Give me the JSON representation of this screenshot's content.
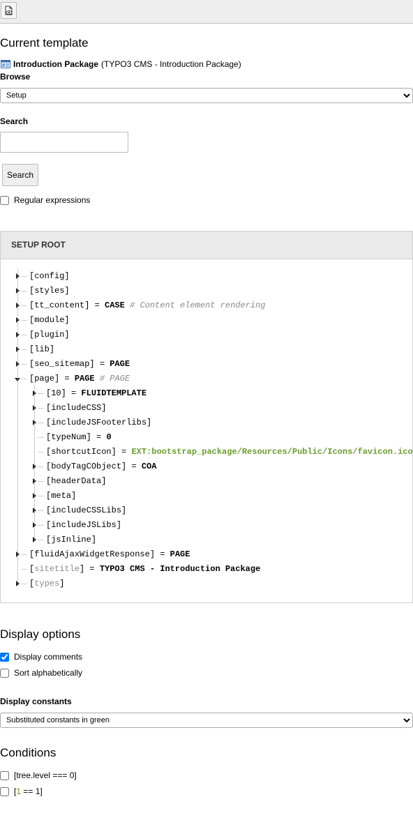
{
  "toolbar": {
    "view_icon": "view-document-icon"
  },
  "current_template": {
    "heading": "Current template",
    "name": "Introduction Package",
    "detail": "(TYPO3 CMS - Introduction Package)"
  },
  "browse": {
    "label": "Browse",
    "selected": "Setup"
  },
  "search": {
    "label": "Search",
    "value": "",
    "button": "Search",
    "regex_label": "Regular expressions",
    "regex_checked": false
  },
  "tree_panel": {
    "title": "SETUP ROOT",
    "nodes": [
      {
        "key": "config",
        "expander": "collapsed",
        "level": 0
      },
      {
        "key": "styles",
        "expander": "collapsed",
        "level": 0
      },
      {
        "key": "tt_content",
        "op": " = ",
        "value": "CASE",
        "comment": "# Content element rendering",
        "expander": "collapsed",
        "level": 0
      },
      {
        "key": "module",
        "expander": "collapsed",
        "level": 0
      },
      {
        "key": "plugin",
        "expander": "collapsed",
        "level": 0
      },
      {
        "key": "lib",
        "expander": "collapsed",
        "level": 0
      },
      {
        "key": "seo_sitemap",
        "op": " = ",
        "value": "PAGE",
        "expander": "collapsed",
        "level": 0
      },
      {
        "key": "page",
        "op": " = ",
        "value": "PAGE",
        "comment": "# PAGE",
        "expander": "expanded",
        "level": 0
      },
      {
        "key": "10",
        "op": " = ",
        "value": "FLUIDTEMPLATE",
        "expander": "collapsed",
        "level": 1
      },
      {
        "key": "includeCSS",
        "expander": "collapsed",
        "level": 1
      },
      {
        "key": "includeJSFooterlibs",
        "expander": "collapsed",
        "level": 1
      },
      {
        "key": "typeNum",
        "op": " = ",
        "value": "0",
        "expander": "none",
        "level": 1
      },
      {
        "key": "shortcutIcon",
        "op": " = ",
        "value": "EXT:bootstrap_package/Resources/Public/Icons/favicon.ico",
        "value_style": "constant",
        "expander": "none",
        "level": 1
      },
      {
        "key": "bodyTagCObject",
        "op": " = ",
        "value": "COA",
        "expander": "collapsed",
        "level": 1
      },
      {
        "key": "headerData",
        "expander": "collapsed",
        "level": 1
      },
      {
        "key": "meta",
        "expander": "collapsed",
        "level": 1
      },
      {
        "key": "includeCSSLibs",
        "expander": "collapsed",
        "level": 1
      },
      {
        "key": "includeJSLibs",
        "expander": "collapsed",
        "level": 1
      },
      {
        "key": "jsInline",
        "expander": "collapsed",
        "level": 1
      },
      {
        "key": "fluidAjaxWidgetResponse",
        "op": " = ",
        "value": "PAGE",
        "expander": "collapsed",
        "level": 0
      },
      {
        "key": "sitetitle",
        "key_style": "grey",
        "op": " = ",
        "value": "TYPO3 CMS - Introduction Package",
        "expander": "none",
        "level": 0
      },
      {
        "key": "types",
        "key_style": "grey",
        "expander": "collapsed",
        "level": 0
      }
    ]
  },
  "display_options": {
    "heading": "Display options",
    "display_comments": {
      "label": "Display comments",
      "checked": true
    },
    "sort_alpha": {
      "label": "Sort alphabetically",
      "checked": false
    },
    "constants_label": "Display constants",
    "constants_selected": "Substituted constants in green"
  },
  "conditions": {
    "heading": "Conditions",
    "items": [
      {
        "pre": "[tree.level === 0]",
        "num": "",
        "post": "",
        "checked": false
      },
      {
        "pre": "[",
        "num": "1",
        "post": " == 1]",
        "checked": false
      }
    ]
  },
  "colors": {
    "constant_green": "#6b9e2e",
    "panel_header_bg": "#eaeaea",
    "topbar_bg": "#eeeeee"
  }
}
